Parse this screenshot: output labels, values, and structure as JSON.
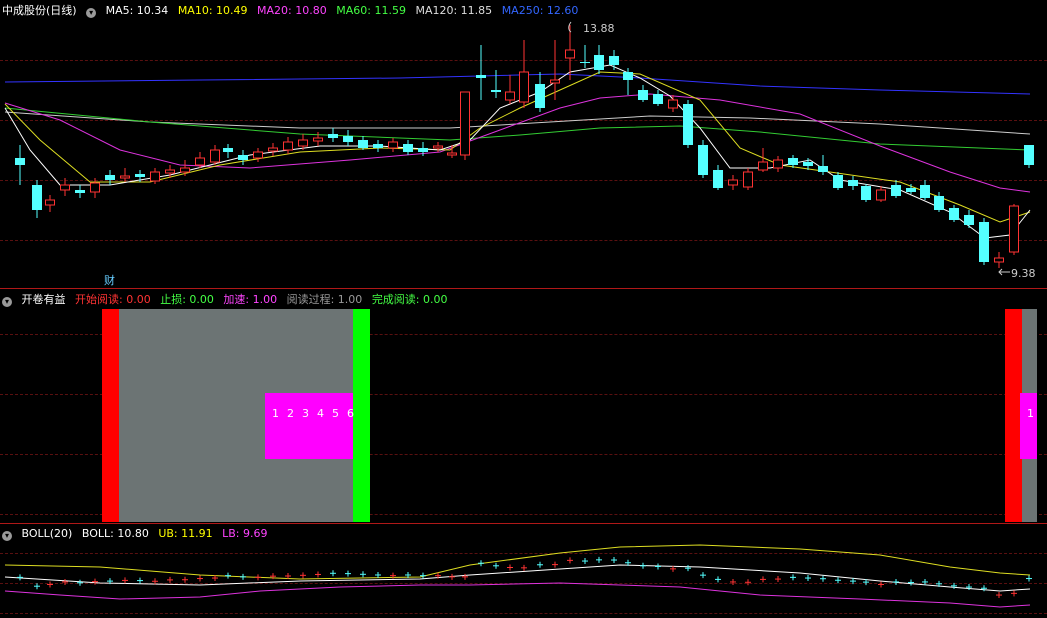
{
  "main": {
    "title": "中成股份(日线)",
    "ma": [
      {
        "label": "MA5: 10.34",
        "color": "#ffffff"
      },
      {
        "label": "MA10: 10.49",
        "color": "#ffff00"
      },
      {
        "label": "MA20: 10.80",
        "color": "#ff44ff"
      },
      {
        "label": "MA60: 11.59",
        "color": "#44ff44"
      },
      {
        "label": "MA120: 11.85",
        "color": "#dddddd"
      },
      {
        "label": "MA250: 12.60",
        "color": "#3333ff"
      }
    ],
    "high_label": "13.88",
    "low_label": "9.38",
    "finance_marker": "财"
  },
  "indicator": {
    "title": "开卷有益",
    "items": [
      {
        "label": "开始阅读: 0.00",
        "color": "#ff3333"
      },
      {
        "label": "止损: 0.00",
        "color": "#44ff44"
      },
      {
        "label": "加速: 1.00",
        "color": "#ff44ff"
      },
      {
        "label": "阅读过程: 1.00",
        "color": "#999999"
      },
      {
        "label": "完成阅读: 0.00",
        "color": "#44ff44"
      }
    ],
    "counts": [
      "1",
      "2",
      "3",
      "4",
      "5",
      "6"
    ],
    "right_count": "1"
  },
  "boll": {
    "title": "BOLL(20)",
    "items": [
      {
        "label": "BOLL: 10.80",
        "color": "#ffffff"
      },
      {
        "label": "UB: 11.91",
        "color": "#ffff00"
      },
      {
        "label": "LB: 9.69",
        "color": "#ff44ff"
      }
    ]
  },
  "colors": {
    "up": "#ff3333",
    "down": "#54ffff",
    "separator": "#b01818"
  }
}
